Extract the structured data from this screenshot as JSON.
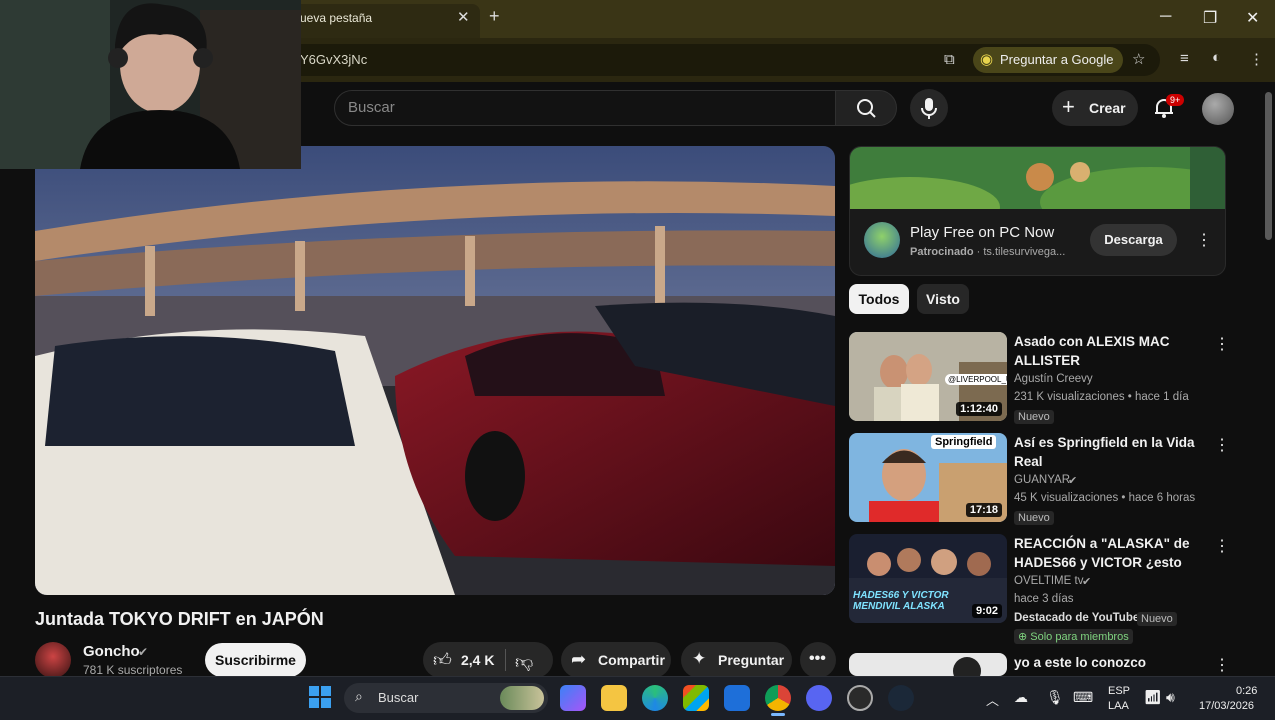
{
  "browser": {
    "tab_title": "ueva pestaña",
    "url": "Y6GvX3jNc",
    "ask_google": "Preguntar a Google"
  },
  "header": {
    "search_placeholder": "Buscar",
    "create_label": "Crear",
    "notif_count": "9+"
  },
  "video": {
    "title": "Juntada TOKYO DRIFT en JAPÓN",
    "channel": "Goncho",
    "subscribers": "781 K suscriptores",
    "subscribe_label": "Suscribirme",
    "likes": "2,4 K",
    "share_label": "Compartir",
    "ask_label": "Preguntar"
  },
  "ad": {
    "title": "Play Free on PC Now",
    "sponsored": "Patrocinado",
    "domain": "ts.tilesurvivega...",
    "cta": "Descarga"
  },
  "chips": [
    "Todos",
    "Visto"
  ],
  "recommendations": [
    {
      "title": "Asado con ALEXIS MAC ALLISTER",
      "channel": "Agustín Creevy",
      "meta": "231 K visualizaciones • hace 1 día",
      "badge": "Nuevo",
      "duration": "1:12:40",
      "thumb_text": "@LIVERPOOL_UK"
    },
    {
      "title": "Así es Springfield en la Vida Real",
      "channel": "GUANYAR",
      "meta": "45 K visualizaciones • hace 6 horas",
      "badge": "Nuevo",
      "duration": "17:18",
      "thumb_text": "Springfield"
    },
    {
      "title": "REACCIÓN a \"ALASKA\" de HADES66 y VICTOR ¿esto nod ...",
      "channel": "OVELTIME tv",
      "meta": "hace 3 días",
      "badge": "Nuevo",
      "extra": "Destacado de YouTube",
      "members": "Solo para miembros",
      "duration": "9:02",
      "thumb_text": "HADES66 Y VICTOR MENDIVIL ALASKA"
    },
    {
      "title": "yo a este lo conozco"
    }
  ],
  "taskbar": {
    "search_label": "Buscar",
    "lang": "ESP",
    "lang2": "LAA",
    "time": "0:26",
    "date": "17/03/2026"
  }
}
